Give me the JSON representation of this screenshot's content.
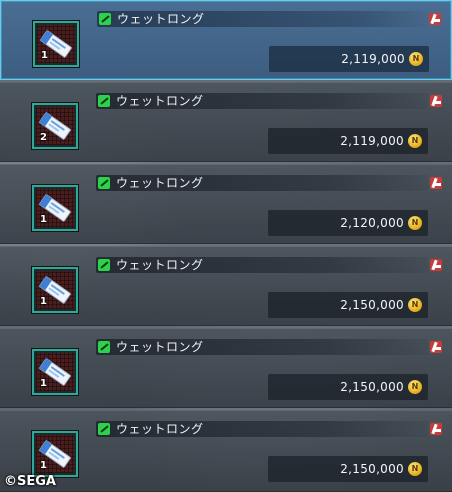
{
  "listings": [
    {
      "name": "ウェットロング",
      "quantity": "1",
      "price": "2,119,000",
      "selected": true
    },
    {
      "name": "ウェットロング",
      "quantity": "2",
      "price": "2,119,000",
      "selected": false
    },
    {
      "name": "ウェットロング",
      "quantity": "1",
      "price": "2,120,000",
      "selected": false
    },
    {
      "name": "ウェットロング",
      "quantity": "1",
      "price": "2,150,000",
      "selected": false
    },
    {
      "name": "ウェットロング",
      "quantity": "1",
      "price": "2,150,000",
      "selected": false
    },
    {
      "name": "ウェットロング",
      "quantity": "1",
      "price": "2,150,000",
      "selected": false
    }
  ],
  "icons": {
    "category": "weapon-category-icon",
    "item": "ticket-icon",
    "pin": "pin-icon",
    "currency": "meseta-icon"
  },
  "colors": {
    "selected_border": "#5fd0f0",
    "selected_bg": "#4a6e93",
    "row_bg": "#48505a",
    "category_green": "#2bd24a",
    "icon_frame": "#2fa89a",
    "meseta_gold": "#e3a914"
  },
  "copyright": "©SEGA"
}
